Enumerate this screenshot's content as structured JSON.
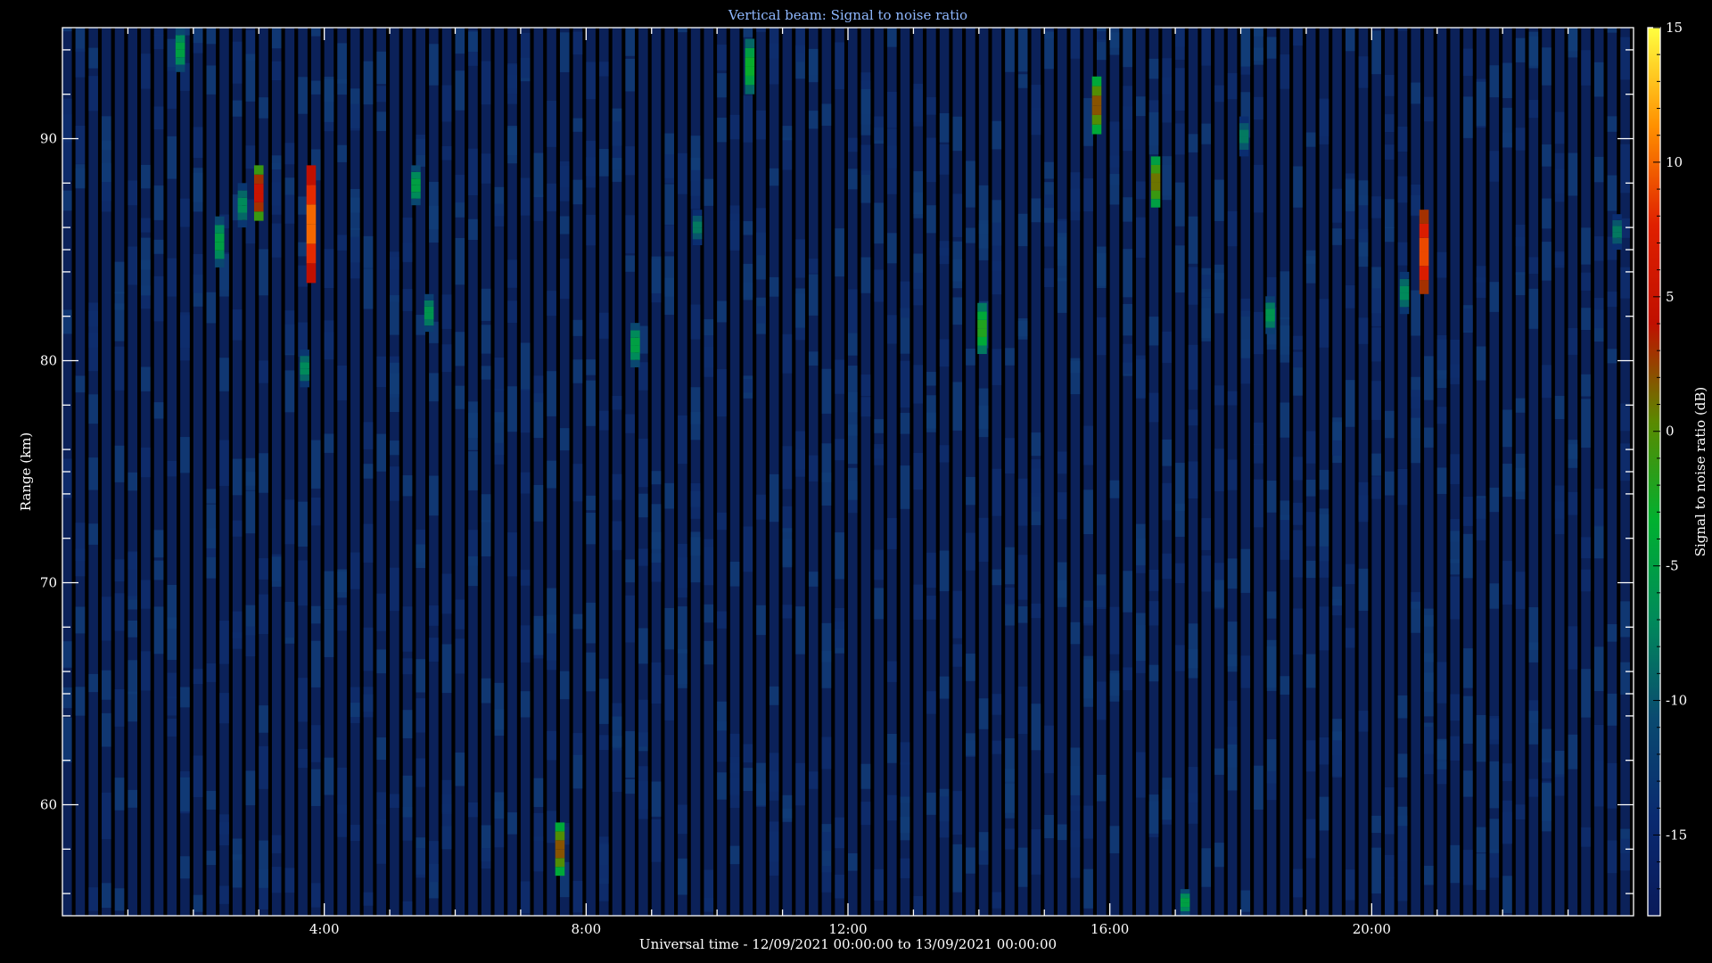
{
  "chart_data": {
    "type": "heatmap",
    "title": "Vertical beam: Signal to noise ratio",
    "xlabel": "Universal time - 12/09/2021 00:00:00 to 13/09/2021 00:00:00",
    "ylabel": "Range (km)",
    "colorbar_label": "Signal to noise ratio (dB)",
    "x_unit": "hours UT",
    "xlim": [
      0,
      24
    ],
    "ylim": [
      55,
      95
    ],
    "x_ticks": [
      {
        "value": 4,
        "label": "4:00"
      },
      {
        "value": 8,
        "label": "8:00"
      },
      {
        "value": 12,
        "label": "12:00"
      },
      {
        "value": 16,
        "label": "16:00"
      },
      {
        "value": 20,
        "label": "20:00"
      }
    ],
    "y_ticks": [
      {
        "value": 60,
        "label": "60"
      },
      {
        "value": 70,
        "label": "70"
      },
      {
        "value": 80,
        "label": "80"
      },
      {
        "value": 90,
        "label": "90"
      }
    ],
    "clim": [
      -18,
      15
    ],
    "colorbar_ticks": [
      {
        "value": -15,
        "label": "-15"
      },
      {
        "value": -10,
        "label": "-10"
      },
      {
        "value": -5,
        "label": "-5"
      },
      {
        "value": 0,
        "label": "0"
      },
      {
        "value": 5,
        "label": "5"
      },
      {
        "value": 10,
        "label": "10"
      },
      {
        "value": 15,
        "label": "15"
      }
    ],
    "colormap": [
      "#0a1a5a",
      "#0a2a70",
      "#0a4a70",
      "#008a5a",
      "#00b030",
      "#5a8a00",
      "#c01000",
      "#e02000",
      "#ff9000",
      "#ffff40"
    ],
    "background_color": "#0b2159",
    "echoes": [
      {
        "t": 1.8,
        "r0": 93.0,
        "r1": 95.0,
        "snr": -5
      },
      {
        "t": 2.4,
        "r0": 84.2,
        "r1": 86.5,
        "snr": -5
      },
      {
        "t": 2.75,
        "r0": 86.0,
        "r1": 88.0,
        "snr": -7
      },
      {
        "t": 3.0,
        "r0": 86.3,
        "r1": 88.8,
        "snr": 5
      },
      {
        "t": 3.7,
        "r0": 78.8,
        "r1": 80.5,
        "snr": -7
      },
      {
        "t": 3.8,
        "r0": 83.5,
        "r1": 88.8,
        "snr": 10
      },
      {
        "t": 5.4,
        "r0": 87.0,
        "r1": 88.8,
        "snr": -5
      },
      {
        "t": 5.6,
        "r0": 81.3,
        "r1": 83.0,
        "snr": -6
      },
      {
        "t": 7.6,
        "r0": 56.8,
        "r1": 59.2,
        "snr": 2
      },
      {
        "t": 8.75,
        "r0": 79.7,
        "r1": 81.7,
        "snr": -5
      },
      {
        "t": 9.7,
        "r0": 85.2,
        "r1": 86.8,
        "snr": -8
      },
      {
        "t": 10.5,
        "r0": 92.0,
        "r1": 94.5,
        "snr": -3
      },
      {
        "t": 14.05,
        "r0": 80.3,
        "r1": 82.6,
        "snr": -2
      },
      {
        "t": 15.8,
        "r0": 90.2,
        "r1": 92.8,
        "snr": 2
      },
      {
        "t": 16.7,
        "r0": 86.9,
        "r1": 89.2,
        "snr": 1
      },
      {
        "t": 17.15,
        "r0": 55.0,
        "r1": 56.2,
        "snr": -5
      },
      {
        "t": 18.05,
        "r0": 89.2,
        "r1": 91.0,
        "snr": -8
      },
      {
        "t": 18.45,
        "r0": 81.2,
        "r1": 82.9,
        "snr": -6
      },
      {
        "t": 20.5,
        "r0": 82.1,
        "r1": 84.0,
        "snr": -7
      },
      {
        "t": 20.8,
        "r0": 83.0,
        "r1": 86.8,
        "snr": 9
      },
      {
        "t": 23.75,
        "r0": 85.0,
        "r1": 86.6,
        "snr": -8
      }
    ]
  }
}
